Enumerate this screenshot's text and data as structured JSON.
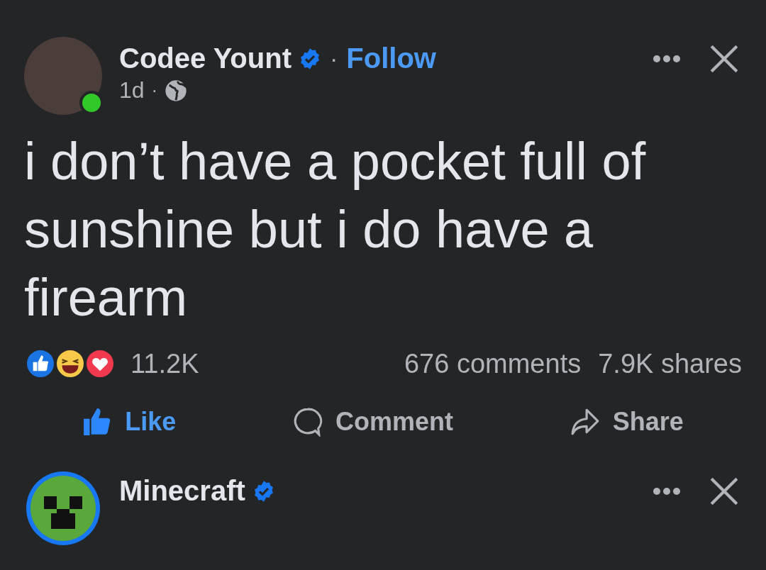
{
  "posts": [
    {
      "kind": "person",
      "author": "Codee Yount",
      "verified": true,
      "online": true,
      "separator": "·",
      "follow": "Follow",
      "time": "1d",
      "time_separator": "·",
      "text": "i don’t have a pocket full of sunshine but i do have a firearm",
      "reactions": [
        {
          "kind": "like"
        },
        {
          "kind": "haha"
        },
        {
          "kind": "love"
        }
      ],
      "reaction_count": "11.2K",
      "comments": "676 comments",
      "shares": "7.9K shares",
      "actions": [
        {
          "kind": "like",
          "label": "Like",
          "selected": true
        },
        {
          "kind": "comment",
          "label": "Comment",
          "selected": false
        },
        {
          "kind": "share",
          "label": "Share",
          "selected": false
        }
      ]
    },
    {
      "kind": "page",
      "author": "Minecraft",
      "verified": true
    }
  ]
}
